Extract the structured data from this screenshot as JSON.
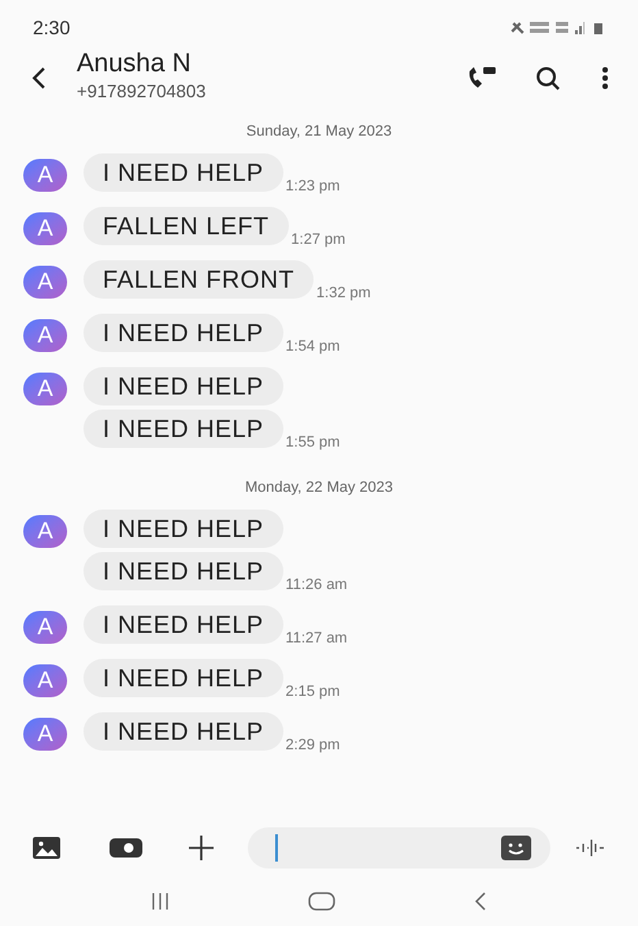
{
  "status_bar": {
    "time": "2:30"
  },
  "header": {
    "name": "Anusha N",
    "phone": "+917892704803"
  },
  "messages": [
    {
      "kind": "date",
      "text": "Sunday, 21 May 2023"
    },
    {
      "kind": "message",
      "avatar": "A",
      "text": "I NEED HELP",
      "time": "1:23 pm"
    },
    {
      "kind": "message",
      "avatar": "A",
      "text": "FALLEN LEFT",
      "time": "1:27 pm"
    },
    {
      "kind": "message",
      "avatar": "A",
      "text": "FALLEN FRONT",
      "time": "1:32 pm"
    },
    {
      "kind": "message",
      "avatar": "A",
      "text": "I NEED HELP",
      "time": "1:54 pm"
    },
    {
      "kind": "message",
      "avatar": "A",
      "text": "I NEED HELP"
    },
    {
      "kind": "message",
      "text": "I NEED HELP",
      "time": "1:55 pm"
    },
    {
      "kind": "date",
      "text": "Monday, 22 May 2023"
    },
    {
      "kind": "message",
      "avatar": "A",
      "text": "I NEED HELP"
    },
    {
      "kind": "message",
      "text": "I NEED HELP",
      "time": "11:26 am"
    },
    {
      "kind": "message",
      "avatar": "A",
      "text": "I NEED HELP",
      "time": "11:27 am"
    },
    {
      "kind": "message",
      "avatar": "A",
      "text": "I NEED HELP",
      "time": "2:15 pm"
    },
    {
      "kind": "message",
      "avatar": "A",
      "text": "I NEED HELP",
      "time": "2:29 pm"
    }
  ]
}
